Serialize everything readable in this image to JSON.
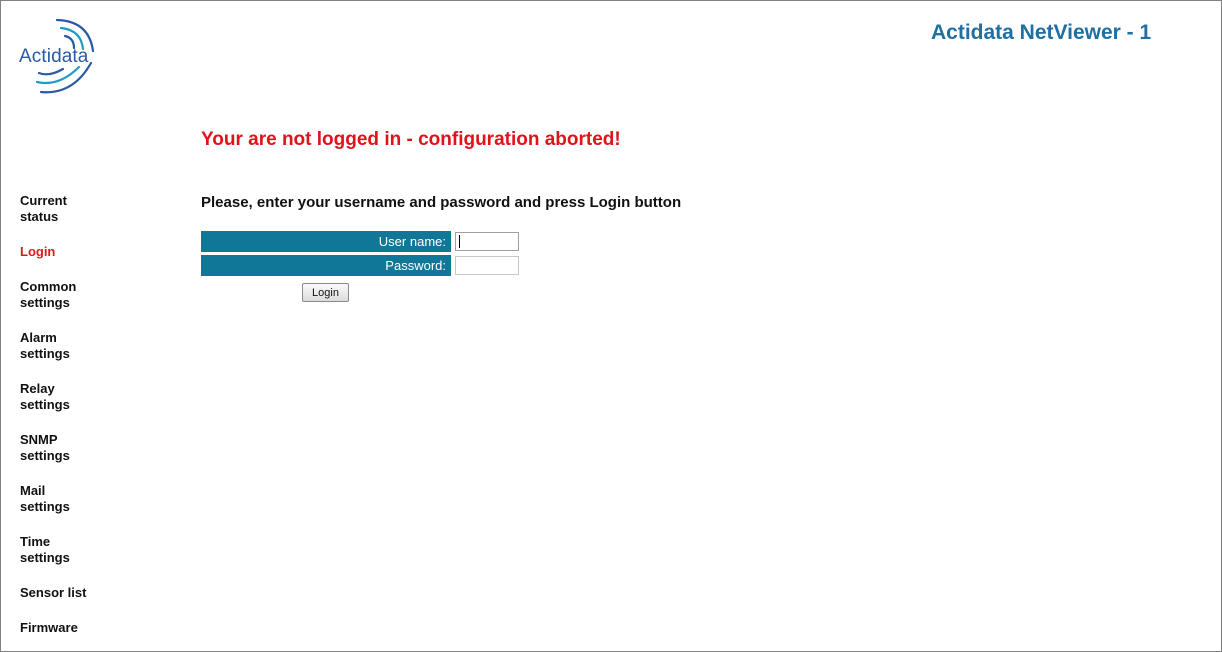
{
  "header": {
    "logo_text": "Actidata",
    "title": "Actidata NetViewer - 1"
  },
  "alert": "Your are not logged in - configuration aborted!",
  "instructions": "Please, enter your username and password and press Login button",
  "sidebar": {
    "items": [
      {
        "label": "Current status",
        "active": false
      },
      {
        "label": "Login",
        "active": true
      },
      {
        "label": "Common settings",
        "active": false
      },
      {
        "label": "Alarm settings",
        "active": false
      },
      {
        "label": "Relay settings",
        "active": false
      },
      {
        "label": "SNMP settings",
        "active": false
      },
      {
        "label": "Mail settings",
        "active": false
      },
      {
        "label": "Time settings",
        "active": false
      },
      {
        "label": "Sensor list",
        "active": false
      },
      {
        "label": "Firmware",
        "active": false
      }
    ]
  },
  "form": {
    "username_label": "User name:",
    "username_value": "",
    "password_label": "Password:",
    "password_value": "",
    "login_button": "Login"
  },
  "colors": {
    "accent": "#117798",
    "title": "#1f6fa3",
    "alert": "#e0131a",
    "active_nav": "#d81b1b",
    "logo": "#2a5aa6"
  }
}
